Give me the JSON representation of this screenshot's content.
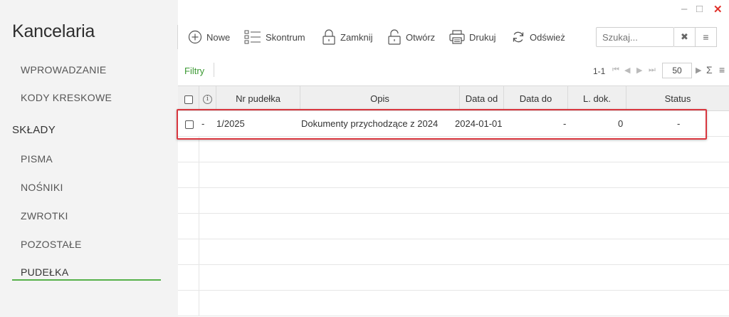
{
  "window": {
    "minimize": "–",
    "maximize": "□",
    "close": "✕"
  },
  "sidebar": {
    "title": "Kancelaria",
    "items": [
      {
        "label": "WPROWADZANIE"
      },
      {
        "label": "KODY KRESKOWE"
      }
    ],
    "section": "SKŁADY",
    "section_items": [
      {
        "label": "PISMA"
      },
      {
        "label": "NOŚNIKI"
      },
      {
        "label": "ZWROTKI"
      },
      {
        "label": "POZOSTAŁE"
      },
      {
        "label": "PUDEŁKA",
        "active": true
      }
    ],
    "accent_color": "#56b14a"
  },
  "toolbar": {
    "new_label": "Nowe",
    "skontrum_label": "Skontrum",
    "close_label": "Zamknij",
    "open_label": "Otwórz",
    "print_label": "Drukuj",
    "refresh_label": "Odśwież",
    "search_placeholder": "Szukaj...",
    "search_clear": "✖",
    "search_menu": "≡"
  },
  "filter_bar": {
    "filter_label": "Filtry",
    "range": "1-1",
    "page_size": "50",
    "first": "⏮",
    "prev": "◀",
    "next": "▶",
    "last": "⏭",
    "next_arrow": "▶",
    "sum": "Σ",
    "menu": "≡"
  },
  "table": {
    "columns": [
      "Nr pudełka",
      "Opis",
      "Data od",
      "Data do",
      "L. dok.",
      "Status"
    ],
    "info_symbol": "i",
    "rows": [
      {
        "marker": "-",
        "nr": "1/2025",
        "opis": "Dokumenty przychodzące z 2024",
        "data_od": "2024-01-01",
        "data_do": "-",
        "l_dok": "0",
        "status": "-"
      }
    ],
    "highlight_color": "#d9363e"
  }
}
